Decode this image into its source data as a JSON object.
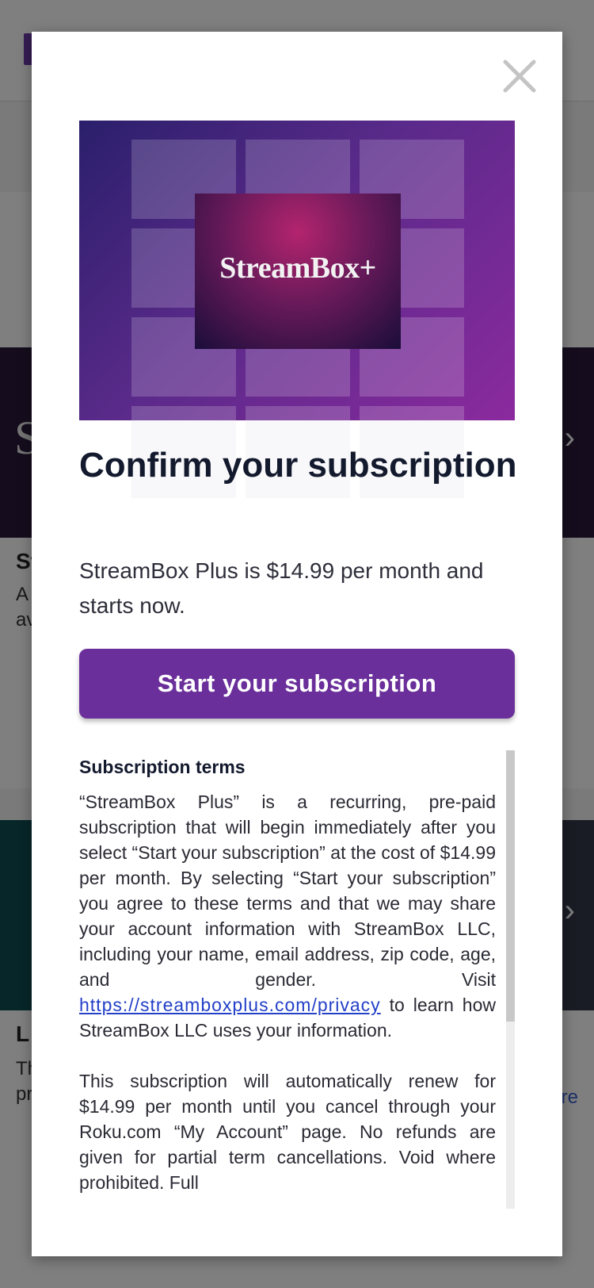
{
  "background": {
    "card1_letter": "S",
    "card1_title": "St",
    "card1_line1": "A",
    "card1_line2": "av",
    "card2_title": "L",
    "card2_line1": "Th",
    "card2_line2": "pr",
    "card2_more": "re"
  },
  "modal": {
    "close_icon": "close-icon",
    "hero": {
      "logo_text": "StreamBox+",
      "gradient_colors": [
        "#2a1f6b",
        "#5a2a8a",
        "#8b2a9e"
      ]
    },
    "title": "Confirm your subscription",
    "subtitle": "StreamBox Plus is $14.99 per month and starts now.",
    "cta_label": "Start your subscription",
    "terms": {
      "heading": "Subscription terms",
      "paragraph1_before_link": "“StreamBox Plus” is a recurring, pre-paid subscription that will begin immediately after you select “Start your subscription” at the cost of $14.99 per month. By selecting “Start your subscription” you agree to these terms and that we may share your account information with StreamBox LLC, including your name, email address, zip code, age, and gender. Visit ",
      "link_text": "https://streamboxplus.com/privacy",
      "paragraph1_after_link": " to learn how StreamBox LLC uses your information.",
      "paragraph2": "This subscription will automatically renew for $14.99 per month until you cancel through your Roku.com “My Account” page. No refunds are given for partial term cancellations. Void where prohibited. Full"
    }
  },
  "colors": {
    "accent": "#6a2f9a",
    "link": "#2340c8",
    "title": "#141a2e"
  }
}
